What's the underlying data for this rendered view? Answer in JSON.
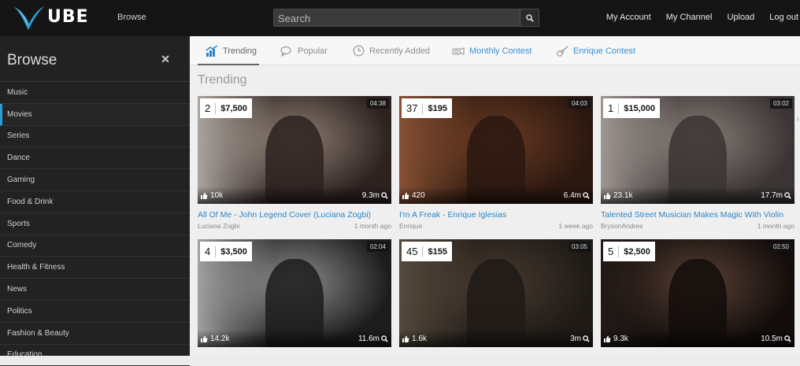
{
  "app": {
    "logo_text": "UBE",
    "top_browse": "Browse",
    "search_placeholder": "Search",
    "nav": [
      "My Account",
      "My Channel",
      "Upload",
      "Log out"
    ]
  },
  "sidebar": {
    "title": "Browse",
    "close_icon": "close-icon",
    "items": [
      {
        "label": "Music"
      },
      {
        "label": "Movies",
        "active": true
      },
      {
        "label": "Series"
      },
      {
        "label": "Dance"
      },
      {
        "label": "Gaming"
      },
      {
        "label": "Food & Drink"
      },
      {
        "label": "Sports"
      },
      {
        "label": "Comedy"
      },
      {
        "label": "Health & Fitness"
      },
      {
        "label": "News"
      },
      {
        "label": "Politics"
      },
      {
        "label": "Fashion & Beauty"
      },
      {
        "label": "Education"
      }
    ]
  },
  "tabs": [
    {
      "label": "Trending",
      "icon": "trending-chart-icon",
      "active": true
    },
    {
      "label": "Popular",
      "icon": "chat-bubble-icon"
    },
    {
      "label": "Recently Added",
      "icon": "clock-icon"
    },
    {
      "label": "Monthly Contest",
      "icon": "contest-icon",
      "color": "#3a8fd0"
    },
    {
      "label": "Enrique Contest",
      "icon": "guitar-icon",
      "color": "#3a8fd0"
    }
  ],
  "section_title": "Trending",
  "videos": [
    {
      "rank": "2",
      "prize": "$7,500",
      "duration": "04:38",
      "likes": "10k",
      "views": "9.3m",
      "title": "All Of Me - John Legend Cover (Luciana Zogbi)",
      "author": "Luciana Zogbi",
      "age": "1 month ago",
      "colors": [
        "#e2dcd4",
        "#8f7f74",
        "#2d2220"
      ]
    },
    {
      "rank": "37",
      "prize": "$195",
      "duration": "04:03",
      "likes": "420",
      "views": "6.4m",
      "title": "I'm A Freak - Enrique Iglesias",
      "author": "Enrique",
      "age": "1 week ago",
      "colors": [
        "#b06a42",
        "#6b3a22",
        "#2a1810"
      ]
    },
    {
      "rank": "1",
      "prize": "$15,000",
      "duration": "03:02",
      "likes": "23.1k",
      "views": "17.7m",
      "title": "Talented Street Musician Makes Magic With Violin",
      "author": "BrysonAndres",
      "age": "1 month ago",
      "colors": [
        "#c9c2bb",
        "#8a7f78",
        "#3a3434"
      ]
    },
    {
      "rank": "4",
      "prize": "$3,500",
      "duration": "02:04",
      "likes": "14.2k",
      "views": "11.6m",
      "title": "",
      "author": "",
      "age": "",
      "colors": [
        "#d9d9d9",
        "#8e8e8e",
        "#1c1c1c"
      ]
    },
    {
      "rank": "45",
      "prize": "$155",
      "duration": "03:05",
      "likes": "1.6k",
      "views": "3m",
      "title": "",
      "author": "",
      "age": "",
      "colors": [
        "#6c5e4d",
        "#463a30",
        "#1f1a16"
      ]
    },
    {
      "rank": "5",
      "prize": "$2,500",
      "duration": "02:50",
      "likes": "9.3k",
      "views": "10.5m",
      "title": "",
      "author": "",
      "age": "",
      "colors": [
        "#2a1f1c",
        "#5a4035",
        "#120d0b"
      ]
    }
  ]
}
